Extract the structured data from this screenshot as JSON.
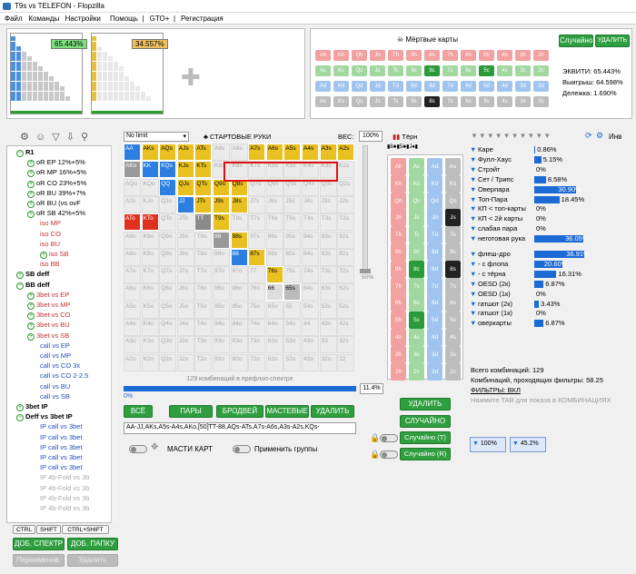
{
  "window": {
    "title": "T9s vs TELEFON - Flopzilla"
  },
  "menu": [
    "Файл",
    "Команды",
    "Настройки",
    "Помощь",
    "|",
    "GTO+",
    "|",
    "Регистрация"
  ],
  "thumbs": [
    {
      "pct": "65.443%",
      "color": "#7ee07e"
    },
    {
      "pct": "34.557%",
      "color": "#f0c060"
    }
  ],
  "board": {
    "title": "Мёртвые карты",
    "random": "Случайно",
    "delete": "УДАЛИТЬ",
    "rows": [
      [
        "Ah",
        "Kh",
        "Qh",
        "Jh",
        "Th",
        "9h",
        "8h",
        "7h",
        "6h",
        "5h",
        "4h",
        "3h",
        "2h"
      ],
      [
        "Ac",
        "Kc",
        "Qc",
        "Jc",
        "Tc",
        "9c",
        "8c",
        "7c",
        "6c",
        "5c",
        "4c",
        "3c",
        "2c"
      ],
      [
        "Ad",
        "Kd",
        "Qd",
        "Jd",
        "Td",
        "9d",
        "8d",
        "7d",
        "6d",
        "5d",
        "4d",
        "3d",
        "2d"
      ],
      [
        "As",
        "Ks",
        "Qs",
        "Js",
        "Ts",
        "9s",
        "8s",
        "7s",
        "6s",
        "5s",
        "4s",
        "3s",
        "2s"
      ]
    ],
    "selected": [
      "8c",
      "8s",
      "5c"
    ],
    "equity": "ЭКВИТИ: 65.443%",
    "wins": "Выигрыш: 64.598%",
    "split": "Дележка: 1.690%"
  },
  "tree": {
    "ctrl": "CTRL",
    "shift": "SHIFT",
    "ctrlshift": "CTRL+SHIFT",
    "add_spectrum": "ДОБ. СПЕКТР",
    "add_folder": "ДОБ. ПАПКУ",
    "rename": "Переименов.",
    "remove": "Удалить",
    "nodes": [
      {
        "t": "R1",
        "lvl": 1,
        "c": "#000",
        "exp": true
      },
      {
        "t": "oR EP 12%+5%",
        "lvl": 2,
        "c": "#000",
        "plus": true
      },
      {
        "t": "oR MP 16%+5%",
        "lvl": 2,
        "c": "#000",
        "plus": true
      },
      {
        "t": "oR CO 23%+5%",
        "lvl": 2,
        "c": "#000",
        "plus": true
      },
      {
        "t": "oR BU 39%+7%",
        "lvl": 2,
        "c": "#000",
        "plus": true
      },
      {
        "t": "oR BU (vs ovF",
        "lvl": 2,
        "c": "#000",
        "plus": true
      },
      {
        "t": "oR SB 42%+5%",
        "lvl": 2,
        "c": "#000",
        "plus": true
      },
      {
        "t": "iso MP",
        "lvl": 3,
        "c": "#c83030"
      },
      {
        "t": "iso CO",
        "lvl": 3,
        "c": "#c83030"
      },
      {
        "t": "iso BU",
        "lvl": 3,
        "c": "#c83030"
      },
      {
        "t": "iso SB",
        "lvl": 3,
        "c": "#c83030",
        "plus": true
      },
      {
        "t": "iso BB",
        "lvl": 3,
        "c": "#c83030"
      },
      {
        "t": "SB deff",
        "lvl": 1,
        "c": "#000",
        "plus": true
      },
      {
        "t": "BB deff",
        "lvl": 1,
        "c": "#000",
        "exp": true
      },
      {
        "t": "3bet vs EP",
        "lvl": 2,
        "c": "#c83030",
        "plus": true
      },
      {
        "t": "3bet vs MP",
        "lvl": 2,
        "c": "#c83030",
        "plus": true
      },
      {
        "t": "3bet vs CO",
        "lvl": 2,
        "c": "#c83030",
        "plus": true
      },
      {
        "t": "3bet vs BU",
        "lvl": 2,
        "c": "#c83030",
        "plus": true
      },
      {
        "t": "3bet vs SB",
        "lvl": 2,
        "c": "#c83030",
        "plus": true
      },
      {
        "t": "call vs EP",
        "lvl": 3,
        "c": "#2050c0"
      },
      {
        "t": "call vs MP",
        "lvl": 3,
        "c": "#2050c0"
      },
      {
        "t": "call vs CO 3x",
        "lvl": 3,
        "c": "#2050c0"
      },
      {
        "t": "call vs CO 2-2.5",
        "lvl": 3,
        "c": "#2050c0"
      },
      {
        "t": "call vs BU",
        "lvl": 3,
        "c": "#2050c0"
      },
      {
        "t": "call vs SB",
        "lvl": 3,
        "c": "#2050c0"
      },
      {
        "t": "3bet IP",
        "lvl": 1,
        "c": "#000",
        "plus": true
      },
      {
        "t": "Deff vs 3bet IP",
        "lvl": 1,
        "c": "#000",
        "exp": true
      },
      {
        "t": "IP call vs 3bet",
        "lvl": 3,
        "c": "#2050c0"
      },
      {
        "t": "IP call vs 3bet",
        "lvl": 3,
        "c": "#2050c0"
      },
      {
        "t": "IP call vs 3bet",
        "lvl": 3,
        "c": "#2050c0"
      },
      {
        "t": "IP call vs 3bet",
        "lvl": 3,
        "c": "#2050c0"
      },
      {
        "t": "IP call vs 3bet",
        "lvl": 3,
        "c": "#2050c0"
      },
      {
        "t": "IP 4b-Fold vs 3b",
        "lvl": 3,
        "c": "#aaa"
      },
      {
        "t": "IP 4b-Fold vs 3b",
        "lvl": 3,
        "c": "#aaa"
      },
      {
        "t": "IP 4b-Fold vs 3b",
        "lvl": 3,
        "c": "#aaa"
      },
      {
        "t": "IP 4b-Fold vs 3b",
        "lvl": 3,
        "c": "#aaa"
      }
    ]
  },
  "range": {
    "limit": "No limit",
    "title": "СТАРТОВЫЕ РУКИ",
    "weight_label": "ВЕС:",
    "weight": "100%",
    "slider_label": "50%",
    "combos": "129 комбинаций в префлоп-спектре",
    "pct": "11.4%",
    "zero": "0%",
    "buttons": {
      "all": "ВСЁ",
      "pairs": "ПАРЫ",
      "broadway": "БРОДВЕЙ",
      "suited": "МАСТЕВЫЕ",
      "del": "УДАЛИТЬ"
    },
    "text": "AA-JJ,AKs,A5s-A4s,AKo,[50]TT-88,AQs-ATs,A7s-A6s,A3s-A2s,KQs-",
    "suits": "МАСТИ КАРТ",
    "groups": "Применить группы",
    "ranks": [
      "A",
      "K",
      "Q",
      "J",
      "T",
      "9",
      "8",
      "7",
      "6",
      "5",
      "4",
      "3",
      "2"
    ]
  },
  "turn": {
    "title": "Тёрн",
    "cards": [
      [
        "Ah",
        "Ac",
        "Ad",
        "As"
      ],
      [
        "Kh",
        "Kc",
        "Kd",
        "Ks"
      ],
      [
        "Qh",
        "Qc",
        "Qd",
        "Qs"
      ],
      [
        "Jh",
        "Jc",
        "Jd",
        "Js"
      ],
      [
        "Th",
        "Tc",
        "Td",
        "Ts"
      ],
      [
        "9h",
        "9c",
        "9d",
        "9s"
      ],
      [
        "8h",
        "8c",
        "8d",
        "8s"
      ],
      [
        "7h",
        "7c",
        "7d",
        "7s"
      ],
      [
        "6h",
        "6c",
        "6d",
        "6s"
      ],
      [
        "5h",
        "5c",
        "5d",
        "5s"
      ],
      [
        "4h",
        "4c",
        "4d",
        "4s"
      ],
      [
        "3h",
        "3c",
        "3d",
        "3s"
      ],
      [
        "2h",
        "2c",
        "2d",
        "2s"
      ]
    ]
  },
  "actions": {
    "del": "УДАЛИТЬ",
    "random": "СЛУЧАЙНО",
    "rand_t": "Случайно (T)",
    "rand_r": "Случайно (R)"
  },
  "stats": {
    "inv": "Инв",
    "rows": [
      {
        "label": "Каре",
        "val": "0.86%",
        "w": 0.86
      },
      {
        "label": "Фулл-Хаус",
        "val": "5.15%",
        "w": 5.15
      },
      {
        "label": "Стрэйт",
        "val": "0%",
        "w": 0
      },
      {
        "label": "Сет / Трипс",
        "val": "8.58%",
        "w": 8.58
      },
      {
        "label": "Оверпара",
        "val": "30.90%",
        "w": 30.9
      },
      {
        "label": "Топ-Пара",
        "val": "18.45%",
        "w": 18.45
      },
      {
        "label": "КП < топ-карты",
        "val": "0%",
        "w": 0
      },
      {
        "label": "КП < 2й карты",
        "val": "0%",
        "w": 0
      },
      {
        "label": "слабая пара",
        "val": "0%",
        "w": 0
      },
      {
        "label": "неготовая рука",
        "val": "36.05%",
        "w": 36.05
      },
      {
        "label": "флеш-дро",
        "val": "36.91%",
        "w": 36.91
      },
      {
        "label": "- с флопа",
        "val": "20.60%",
        "w": 20.6
      },
      {
        "label": "- с тёрна",
        "val": "16.31%",
        "w": 16.31
      },
      {
        "label": "OESD (2к)",
        "val": "6.87%",
        "w": 6.87
      },
      {
        "label": "OESD (1к)",
        "val": "0%",
        "w": 0
      },
      {
        "label": "гатшот (2к)",
        "val": "3.43%",
        "w": 3.43
      },
      {
        "label": "гатшот (1к)",
        "val": "0%",
        "w": 0
      },
      {
        "label": "оверкарты",
        "val": "6.87%",
        "w": 6.87
      }
    ],
    "total": "Всего комбинаций: 129",
    "filtered": "Комбинаций, проходящих фильтры: 58.25",
    "filters": "ФИЛЬТРЫ: ВКЛ",
    "hint": "Нажмите TAB для показа в КОМБИНАЦИЯХ",
    "f1": "100%",
    "f2": "45.2%"
  }
}
